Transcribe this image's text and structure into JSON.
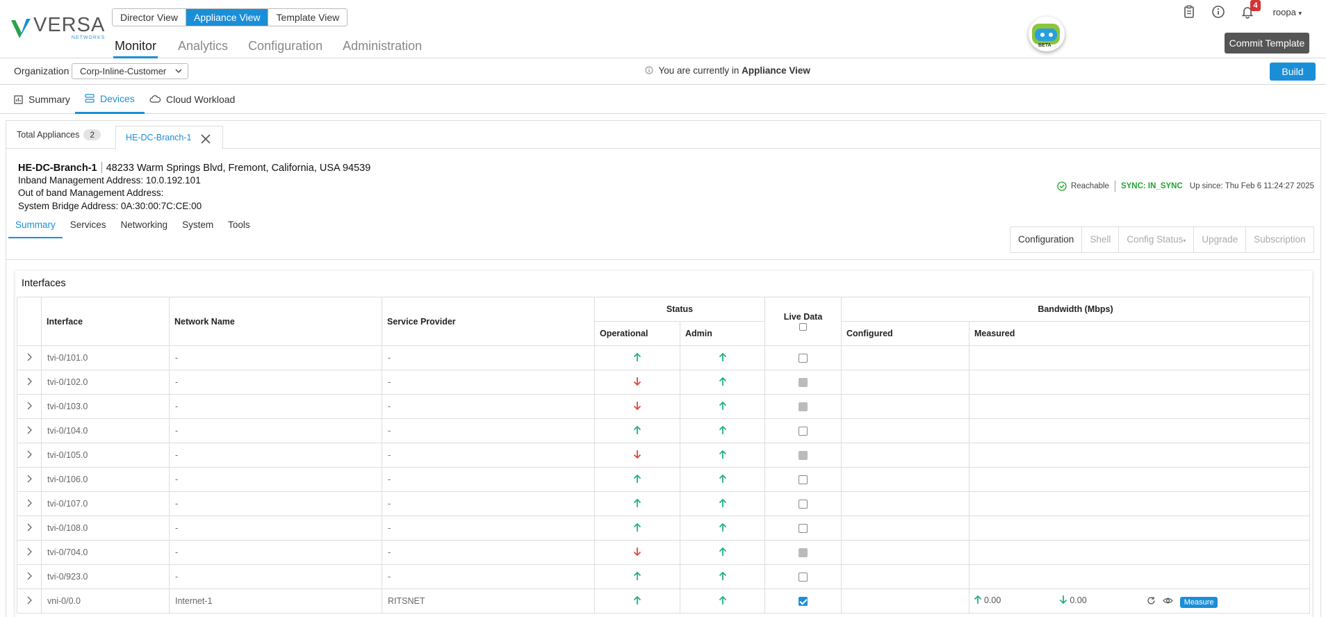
{
  "brand": {
    "name": "VERSA",
    "sub": "NETWORKS"
  },
  "views": [
    {
      "label": "Director View",
      "active": false
    },
    {
      "label": "Appliance View",
      "active": true
    },
    {
      "label": "Template View",
      "active": false
    }
  ],
  "main_nav": [
    {
      "label": "Monitor",
      "active": true
    },
    {
      "label": "Analytics",
      "active": false
    },
    {
      "label": "Configuration",
      "active": false
    },
    {
      "label": "Administration",
      "active": false
    }
  ],
  "assistant": {
    "badge": "BETA"
  },
  "top_icons": {
    "notifications_count": "4",
    "user": "roopa"
  },
  "commit_label": "Commit Template",
  "org": {
    "label": "Organization",
    "value": "Corp-Inline-Customer"
  },
  "appliance_notice": {
    "prefix": "You are currently in",
    "view": "Appliance View"
  },
  "build_label": "Build",
  "subnav": [
    {
      "label": "Summary",
      "icon": "chart-icon"
    },
    {
      "label": "Devices",
      "icon": "devices-icon",
      "active": true
    },
    {
      "label": "Cloud Workload",
      "icon": "cloud-icon"
    }
  ],
  "device_tabs": {
    "total_label": "Total Appliances",
    "total_count": "2",
    "active_tab": "HE-DC-Branch-1"
  },
  "device": {
    "name": "HE-DC-Branch-1",
    "address": "48233 Warm Springs Blvd, Fremont, California, USA 94539",
    "inband": "Inband Management Address: 10.0.192.101",
    "oob": "Out of band Management Address:",
    "bridge": "System Bridge Address: 0A:30:00:7C:CE:00",
    "reachable": "Reachable",
    "sync": "SYNC: IN_SYNC",
    "up_since": "Up since: Thu Feb 6 11:24:27 2025"
  },
  "inner_tabs": [
    "Summary",
    "Services",
    "Networking",
    "System",
    "Tools"
  ],
  "actions": [
    {
      "label": "Configuration",
      "enabled": true
    },
    {
      "label": "Shell",
      "enabled": false
    },
    {
      "label": "Config Status",
      "enabled": false
    },
    {
      "label": "Upgrade",
      "enabled": false
    },
    {
      "label": "Subscription",
      "enabled": false
    }
  ],
  "interfaces": {
    "title": "Interfaces",
    "headers": {
      "interface": "Interface",
      "network": "Network Name",
      "provider": "Service Provider",
      "status": "Status",
      "operational": "Operational",
      "admin": "Admin",
      "live": "Live Data",
      "bandwidth": "Bandwidth (Mbps)",
      "configured": "Configured",
      "measured": "Measured"
    },
    "rows": [
      {
        "iface": "tvi-0/101.0",
        "network": "-",
        "provider": "-",
        "oper": "up",
        "admin": "up",
        "live": "unchecked"
      },
      {
        "iface": "tvi-0/102.0",
        "network": "-",
        "provider": "-",
        "oper": "down",
        "admin": "up",
        "live": "disabled"
      },
      {
        "iface": "tvi-0/103.0",
        "network": "-",
        "provider": "-",
        "oper": "down",
        "admin": "up",
        "live": "disabled"
      },
      {
        "iface": "tvi-0/104.0",
        "network": "-",
        "provider": "-",
        "oper": "up",
        "admin": "up",
        "live": "unchecked"
      },
      {
        "iface": "tvi-0/105.0",
        "network": "-",
        "provider": "-",
        "oper": "down",
        "admin": "up",
        "live": "disabled"
      },
      {
        "iface": "tvi-0/106.0",
        "network": "-",
        "provider": "-",
        "oper": "up",
        "admin": "up",
        "live": "unchecked"
      },
      {
        "iface": "tvi-0/107.0",
        "network": "-",
        "provider": "-",
        "oper": "up",
        "admin": "up",
        "live": "unchecked"
      },
      {
        "iface": "tvi-0/108.0",
        "network": "-",
        "provider": "-",
        "oper": "up",
        "admin": "up",
        "live": "unchecked"
      },
      {
        "iface": "tvi-0/704.0",
        "network": "-",
        "provider": "-",
        "oper": "down",
        "admin": "up",
        "live": "disabled"
      },
      {
        "iface": "tvi-0/923.0",
        "network": "-",
        "provider": "-",
        "oper": "up",
        "admin": "up",
        "live": "unchecked"
      },
      {
        "iface": "vni-0/0.0",
        "network": "Internet-1",
        "provider": "RITSNET",
        "oper": "up",
        "admin": "up",
        "live": "checked",
        "bw_up": "0.00",
        "bw_down": "0.00",
        "measure_label": "Measure"
      }
    ]
  },
  "colors": {
    "accent": "#1a8fd8",
    "up": "#20b47a",
    "down": "#e0463a",
    "sync": "#21a52e"
  }
}
